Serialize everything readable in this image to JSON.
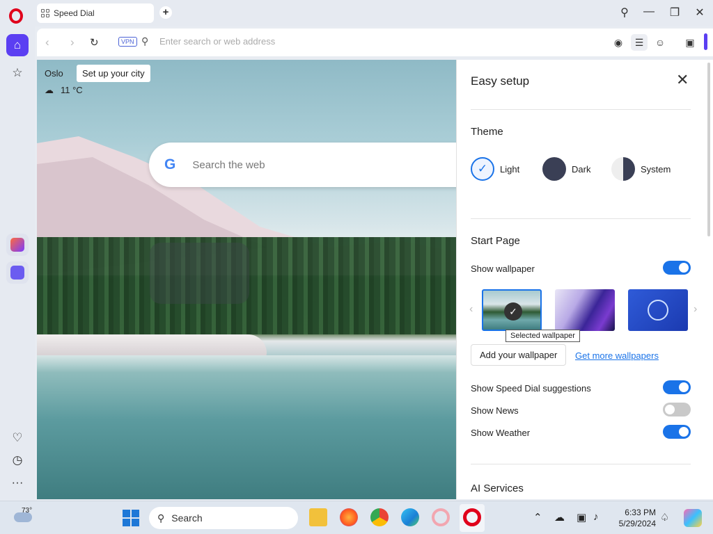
{
  "browser": {
    "tab_title": "Speed Dial",
    "address_placeholder": "Enter search or web address",
    "vpn_label": "VPN"
  },
  "speed_dial": {
    "city": "Oslo",
    "city_prompt": "Set up your city",
    "temperature": "11 °C",
    "search_placeholder": "Search the web",
    "google_letter": "G"
  },
  "easy_setup": {
    "title": "Easy setup",
    "theme_heading": "Theme",
    "themes": [
      {
        "label": "Light",
        "selected": true
      },
      {
        "label": "Dark",
        "selected": false
      },
      {
        "label": "System",
        "selected": false
      }
    ],
    "start_page_heading": "Start Page",
    "show_wallpaper_label": "Show wallpaper",
    "show_wallpaper": true,
    "selected_wallpaper_tooltip": "Selected wallpaper",
    "add_wallpaper_label": "Add your wallpaper",
    "get_more_label": "Get more wallpapers",
    "speed_dial_suggestions_label": "Show Speed Dial suggestions",
    "speed_dial_suggestions": true,
    "news_label": "Show News",
    "news": false,
    "weather_label": "Show Weather",
    "weather": true,
    "ai_services_heading": "AI Services"
  },
  "taskbar": {
    "weather_temp": "73°",
    "search_label": "Search",
    "time": "6:33 PM",
    "date": "5/29/2024"
  },
  "colors": {
    "accent": "#5b3ff2",
    "toggle_on": "#1a73e8",
    "opera_red": "#e0001b"
  }
}
